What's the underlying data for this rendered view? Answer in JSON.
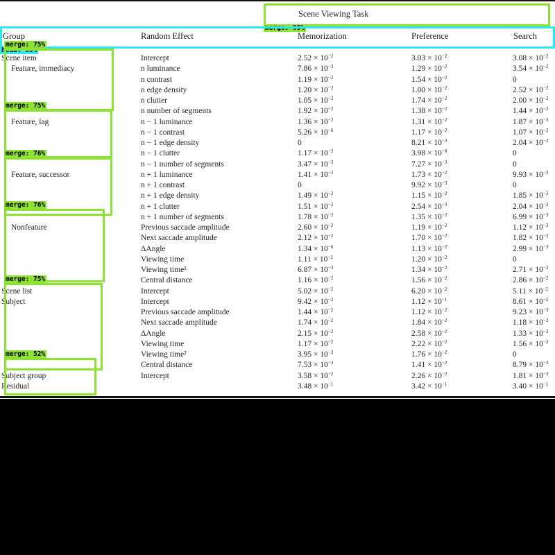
{
  "table": {
    "task_header": "Scene Viewing Task",
    "columns": [
      "Group",
      "Random Effect",
      "Memorization",
      "Preference",
      "Search"
    ],
    "rows": [
      {
        "group": "Scene item",
        "effect": "Intercept",
        "mem": "2.52 × 10",
        "mem_exp": "−2",
        "pref": "3.03 × 10",
        "pref_exp": "−2",
        "search": "3.08 × 10",
        "search_exp": "−2"
      },
      {
        "group": "Feature, immediacy",
        "effect": "n luminance",
        "mem": "7.86 × 10",
        "mem_exp": "−3",
        "pref": "1.29 × 10",
        "pref_exp": "−2",
        "search": "3.54 × 10",
        "search_exp": "−2"
      },
      {
        "group": "",
        "effect": "n contrast",
        "mem": "1.19 × 10",
        "mem_exp": "−2",
        "pref": "1.54 × 10",
        "pref_exp": "−2",
        "search": "0",
        "search_exp": ""
      },
      {
        "group": "",
        "effect": "n edge density",
        "mem": "1.20 × 10",
        "mem_exp": "−2",
        "pref": "1.00 × 10",
        "pref_exp": "−2",
        "search": "2.52 × 10",
        "search_exp": "−2"
      },
      {
        "group": "",
        "effect": "n clutter",
        "mem": "1.05 × 10",
        "mem_exp": "−2",
        "pref": "1.74 × 10",
        "pref_exp": "−2",
        "search": "2.00 × 10",
        "search_exp": "−2"
      },
      {
        "group": "",
        "effect": "n number of segments",
        "mem": "1.92 × 10",
        "mem_exp": "−2",
        "pref": "1.38 × 10",
        "pref_exp": "−2",
        "search": "1.44 × 10",
        "search_exp": "−2"
      },
      {
        "group": "Feature, lag",
        "effect": "n − 1 luminance",
        "mem": "1.36 × 10",
        "mem_exp": "−2",
        "pref": "1.31 × 10",
        "pref_exp": "−2",
        "search": "1.87 × 10",
        "search_exp": "−3"
      },
      {
        "group": "",
        "effect": "n − 1 contrast",
        "mem": "5.26 × 10",
        "mem_exp": "−6",
        "pref": "1.17 × 10",
        "pref_exp": "−2",
        "search": "1.07 × 10",
        "search_exp": "−2"
      },
      {
        "group": "",
        "effect": "n − 1 edge density",
        "mem": "0",
        "mem_exp": "",
        "pref": "8.21 × 10",
        "pref_exp": "−3",
        "search": "2.04 × 10",
        "search_exp": "−2"
      },
      {
        "group": "",
        "effect": "n − 1 clutter",
        "mem": "1.17 × 10",
        "mem_exp": "−2",
        "pref": "3.98 × 10",
        "pref_exp": "−8",
        "search": "0",
        "search_exp": ""
      },
      {
        "group": "",
        "effect": "n − 1 number of segments",
        "mem": "3.47 × 10",
        "mem_exp": "−3",
        "pref": "7.27 × 10",
        "pref_exp": "−3",
        "search": "0",
        "search_exp": ""
      },
      {
        "group": "Feature, successor",
        "effect": "n + 1 luminance",
        "mem": "1.41 × 10",
        "mem_exp": "−2",
        "pref": "1.73 × 10",
        "pref_exp": "−2",
        "search": "9.93 × 10",
        "search_exp": "−3"
      },
      {
        "group": "",
        "effect": "n + 1 contrast",
        "mem": "0",
        "mem_exp": "",
        "pref": "9.92 × 10",
        "pref_exp": "−3",
        "search": "0",
        "search_exp": ""
      },
      {
        "group": "",
        "effect": "n + 1 edge density",
        "mem": "1.49 × 10",
        "mem_exp": "−2",
        "pref": "1.15 × 10",
        "pref_exp": "−2",
        "search": "1.85 × 10",
        "search_exp": "−2"
      },
      {
        "group": "",
        "effect": "n + 1 clutter",
        "mem": "1.51 × 10",
        "mem_exp": "−2",
        "pref": "2.54 × 10",
        "pref_exp": "−3",
        "search": "2.04 × 10",
        "search_exp": "−2"
      },
      {
        "group": "",
        "effect": "n + 1 number of segments",
        "mem": "1.78 × 10",
        "mem_exp": "−2",
        "pref": "1.35 × 10",
        "pref_exp": "−2",
        "search": "6.99 × 10",
        "search_exp": "−3"
      },
      {
        "group": "Nonfeature",
        "effect": "Previous saccade amplitude",
        "mem": "2.60 × 10",
        "mem_exp": "−2",
        "pref": "1.19 × 10",
        "pref_exp": "−2",
        "search": "1.12 × 10",
        "search_exp": "−2"
      },
      {
        "group": "",
        "effect": "Next saccade amplitude",
        "mem": "2.12 × 10",
        "mem_exp": "−2",
        "pref": "1.70 × 10",
        "pref_exp": "−2",
        "search": "1.82 × 10",
        "search_exp": "−2"
      },
      {
        "group": "",
        "effect": "ΔAngle",
        "mem": "1.34 × 10",
        "mem_exp": "−6",
        "pref": "1.13 × 10",
        "pref_exp": "−2",
        "search": "2.99 × 10",
        "search_exp": "−3"
      },
      {
        "group": "",
        "effect": "Viewing time",
        "mem": "1.11 × 10",
        "mem_exp": "−2",
        "pref": "1.20 × 10",
        "pref_exp": "−2",
        "search": "0",
        "search_exp": ""
      },
      {
        "group": "",
        "effect": "Viewing time²",
        "mem": "6.87 × 10",
        "mem_exp": "−3",
        "pref": "1.34 × 10",
        "pref_exp": "−2",
        "search": "2.71 × 10",
        "search_exp": "−2"
      },
      {
        "group": "",
        "effect": "Central distance",
        "mem": "1.16 × 10",
        "mem_exp": "−2",
        "pref": "1.56 × 10",
        "pref_exp": "−2",
        "search": "2.86 × 10",
        "search_exp": "−2"
      },
      {
        "group": "Scene list",
        "effect": "Intercept",
        "mem": "5.02 × 10",
        "mem_exp": "−2",
        "pref": "6.20 × 10",
        "pref_exp": "−2",
        "search": "5.11 × 10",
        "search_exp": "−2"
      },
      {
        "group": "Subject",
        "effect": "Intercept",
        "mem": "9.42 × 10",
        "mem_exp": "−2",
        "pref": "1.12 × 10",
        "pref_exp": "−1",
        "search": "8.61 × 10",
        "search_exp": "−2"
      },
      {
        "group": "",
        "effect": "Previous saccade amplitude",
        "mem": "1.44 × 10",
        "mem_exp": "−2",
        "pref": "1.12 × 10",
        "pref_exp": "−2",
        "search": "9.23 × 10",
        "search_exp": "−3"
      },
      {
        "group": "",
        "effect": "Next saccade amplitude",
        "mem": "1.74 × 10",
        "mem_exp": "−2",
        "pref": "1.84 × 10",
        "pref_exp": "−2",
        "search": "1.18 × 10",
        "search_exp": "−2"
      },
      {
        "group": "",
        "effect": "ΔAngle",
        "mem": "2.15 × 10",
        "mem_exp": "−2",
        "pref": "2.58 × 10",
        "pref_exp": "−2",
        "search": "1.33 × 10",
        "search_exp": "−2"
      },
      {
        "group": "",
        "effect": "Viewing time",
        "mem": "1.17 × 10",
        "mem_exp": "−2",
        "pref": "2.22 × 10",
        "pref_exp": "−2",
        "search": "1.56 × 10",
        "search_exp": "−2"
      },
      {
        "group": "",
        "effect": "Viewing time²",
        "mem": "3.95 × 10",
        "mem_exp": "−3",
        "pref": "1.76 × 10",
        "pref_exp": "−2",
        "search": "0",
        "search_exp": ""
      },
      {
        "group": "",
        "effect": "Central distance",
        "mem": "7.53 × 10",
        "mem_exp": "−3",
        "pref": "1.41 × 10",
        "pref_exp": "−2",
        "search": "8.79 × 10",
        "search_exp": "−3"
      },
      {
        "group": "Subject group",
        "effect": "Intercept",
        "mem": "3.58 × 10",
        "mem_exp": "−2",
        "pref": "2.26 × 10",
        "pref_exp": "−2",
        "search": "1.81 × 10",
        "search_exp": "−3"
      },
      {
        "group": "Residual",
        "effect": "",
        "mem": "3.48 × 10",
        "mem_exp": "−1",
        "pref": "3.42 × 10",
        "pref_exp": "−1",
        "search": "3.40 × 10",
        "search_exp": "−1"
      }
    ]
  },
  "overlays": [
    {
      "label": "merge: 99%",
      "color": "#8ee234"
    },
    {
      "label": "head: 55%",
      "color": "#2ee8ef"
    },
    {
      "label": "merge: 75%",
      "color": "#8ee234"
    },
    {
      "label": "merge: 75%",
      "color": "#8ee234"
    },
    {
      "label": "merge: 76%",
      "color": "#8ee234"
    },
    {
      "label": "merge: 76%",
      "color": "#8ee234"
    },
    {
      "label": "merge: 75%",
      "color": "#8ee234"
    },
    {
      "label": "merge: 52%",
      "color": "#8ee234"
    }
  ]
}
